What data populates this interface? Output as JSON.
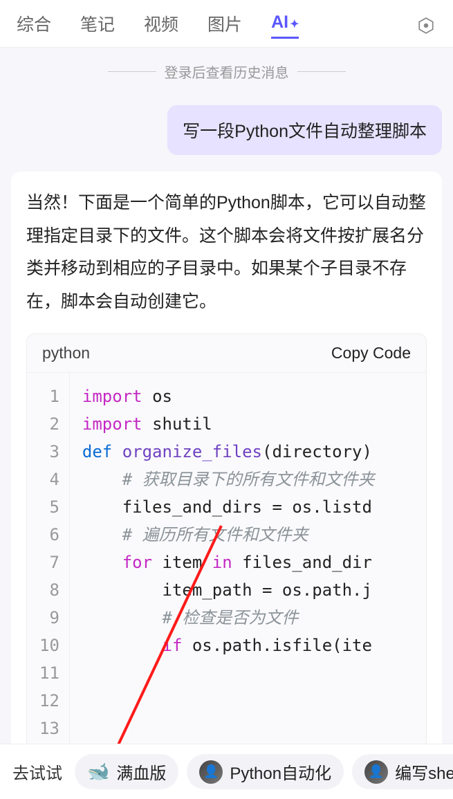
{
  "tabs": {
    "items": [
      {
        "label": "综合"
      },
      {
        "label": "笔记"
      },
      {
        "label": "视频"
      },
      {
        "label": "图片"
      },
      {
        "label": "AI"
      }
    ],
    "active_index": 4
  },
  "login_hint": "登录后查看历史消息",
  "user_message": "写一段Python文件自动整理脚本",
  "assistant_text": "当然！下面是一个简单的Python脚本，它可以自动整理指定目录下的文件。这个脚本会将文件按扩展名分类并移动到相应的子目录中。如果某个子目录不存在，脚本会自动创建它。",
  "code": {
    "language": "python",
    "copy_label": "Copy Code",
    "lines": [
      {
        "n": 1,
        "segs": [
          {
            "t": "import ",
            "c": "kw"
          },
          {
            "t": "os",
            "c": "id"
          }
        ]
      },
      {
        "n": 2,
        "segs": [
          {
            "t": "import ",
            "c": "kw"
          },
          {
            "t": "shutil",
            "c": "id"
          }
        ]
      },
      {
        "n": 3,
        "segs": [
          {
            "t": "",
            "c": "id"
          }
        ]
      },
      {
        "n": 4,
        "segs": [
          {
            "t": "def ",
            "c": "def"
          },
          {
            "t": "organize_files",
            "c": "fn"
          },
          {
            "t": "(directory)",
            "c": "id"
          }
        ]
      },
      {
        "n": 5,
        "segs": [
          {
            "t": "    ",
            "c": "id"
          },
          {
            "t": "# 获取目录下的所有文件和文件夹",
            "c": "cm"
          }
        ]
      },
      {
        "n": 6,
        "segs": [
          {
            "t": "    files_and_dirs = os.listd",
            "c": "id"
          }
        ]
      },
      {
        "n": 7,
        "segs": [
          {
            "t": "",
            "c": "id"
          }
        ]
      },
      {
        "n": 8,
        "segs": [
          {
            "t": "    ",
            "c": "id"
          },
          {
            "t": "# 遍历所有文件和文件夹",
            "c": "cm"
          }
        ]
      },
      {
        "n": 9,
        "segs": [
          {
            "t": "    ",
            "c": "id"
          },
          {
            "t": "for ",
            "c": "kw"
          },
          {
            "t": "item ",
            "c": "id"
          },
          {
            "t": "in ",
            "c": "kw"
          },
          {
            "t": "files_and_dir",
            "c": "id"
          }
        ]
      },
      {
        "n": 10,
        "segs": [
          {
            "t": "        item_path = os.path.j",
            "c": "id"
          }
        ]
      },
      {
        "n": 11,
        "segs": [
          {
            "t": "",
            "c": "id"
          }
        ]
      },
      {
        "n": 12,
        "segs": [
          {
            "t": "        ",
            "c": "id"
          },
          {
            "t": "# 检查是否为文件",
            "c": "cm"
          }
        ]
      },
      {
        "n": 13,
        "segs": [
          {
            "t": "        ",
            "c": "id"
          },
          {
            "t": "if ",
            "c": "kw"
          },
          {
            "t": "os.path.isfile(ite",
            "c": "id"
          }
        ]
      }
    ]
  },
  "footer": {
    "try_label": "去试试",
    "chips": [
      {
        "icon": "whale",
        "label": "满血版"
      },
      {
        "icon": "avatar",
        "label": "Python自动化"
      },
      {
        "icon": "avatar",
        "label": "编写she"
      }
    ]
  }
}
